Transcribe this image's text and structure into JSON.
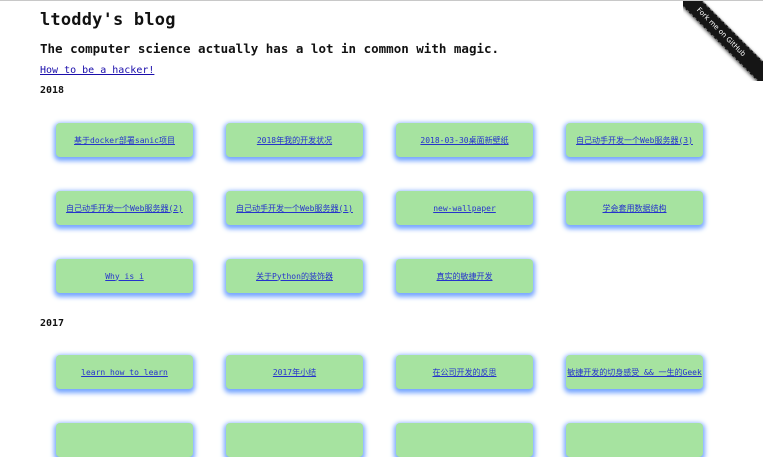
{
  "header": {
    "title": "ltoddy's blog",
    "tagline": "The computer science actually has a lot in common with magic.",
    "hacker_link": "How to be a hacker!"
  },
  "ribbon": {
    "label": "Fork me on GitHub"
  },
  "sections": [
    {
      "year": "2018",
      "posts": [
        "基于docker部署sanic项目",
        "2018年我的开发状况",
        "2018-03-30桌面新壁纸",
        "自己动手开发一个Web服务器(3)",
        "自己动手开发一个Web服务器(2)",
        "自己动手开发一个Web服务器(1)",
        "new-wallpaper",
        "学会套用数据结构",
        "Why is i",
        "关于Python的装饰器",
        "真实的敏捷开发"
      ]
    },
    {
      "year": "2017",
      "posts": [
        "learn how to learn",
        "2017年小结",
        "在公司开发的反思",
        "敏捷开发的切身感受 && 一生的Geek"
      ]
    }
  ],
  "colors": {
    "card_bg": "#a6e3a0",
    "card_glow": "#5f96ff",
    "link": "#2633cc"
  }
}
